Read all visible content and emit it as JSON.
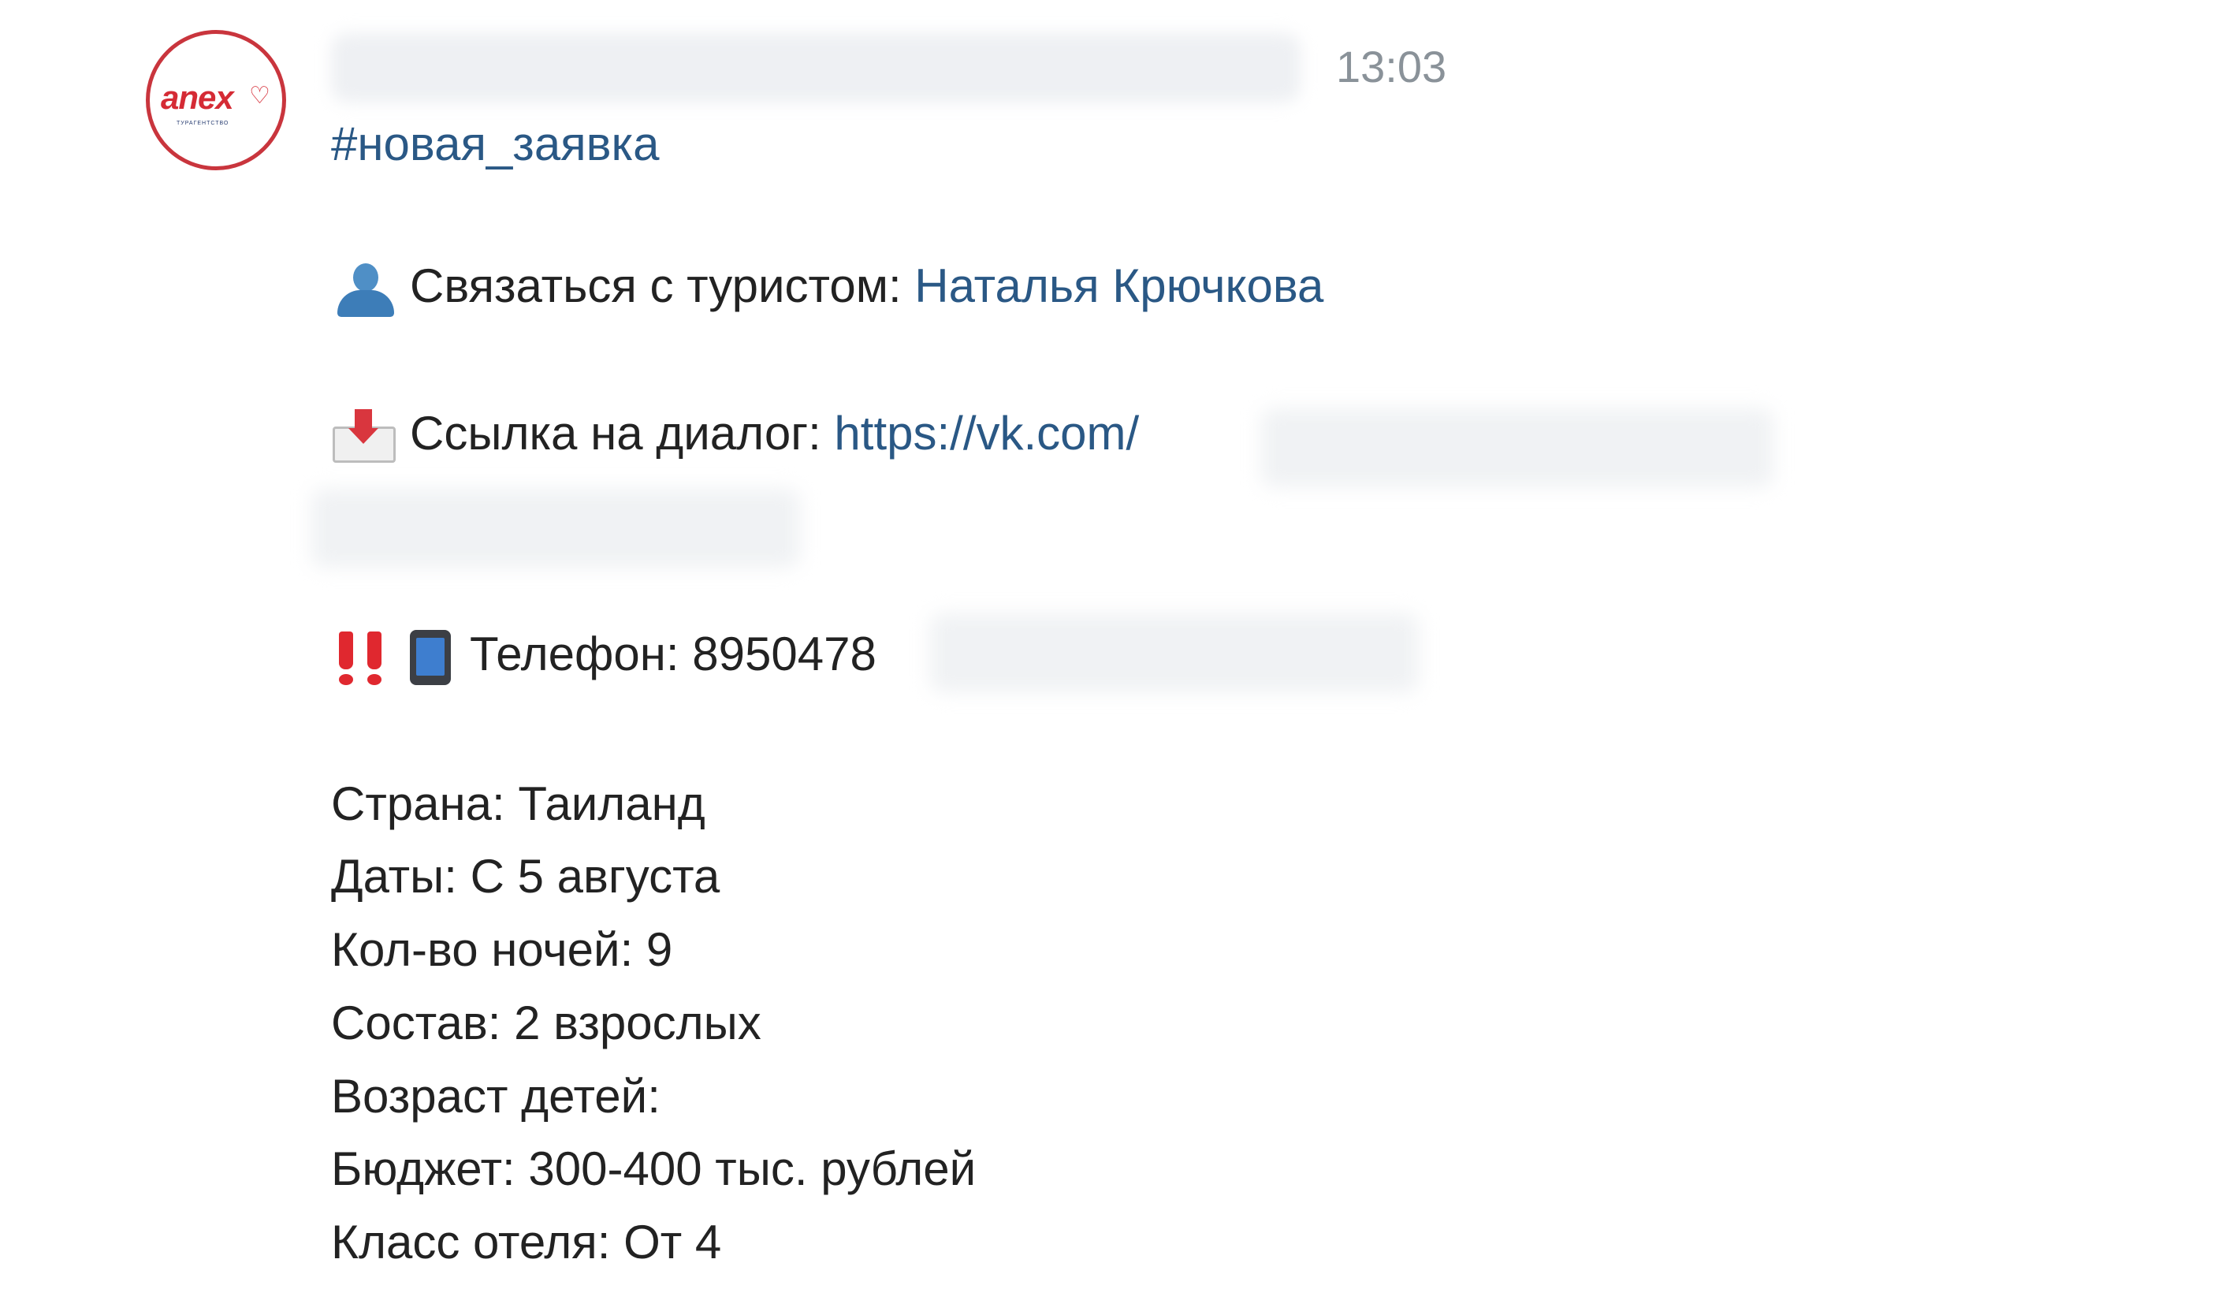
{
  "post": {
    "avatar": {
      "logo_text": "anex",
      "tagline": "ТУРАГЕНТСТВО"
    },
    "author_name": "",
    "timestamp": "13:03",
    "hashtag": "#новая_заявка",
    "contact": {
      "label": "Связаться с туристом: ",
      "name": "Наталья Крючкова"
    },
    "dialog": {
      "label": "Ссылка на диалог: ",
      "url_visible": "https://vk.com/"
    },
    "phone": {
      "label": "Телефон: ",
      "value_visible": "8950478"
    },
    "details": [
      "Страна: Таиланд",
      "Даты: С 5 августа",
      "Кол-во ночей: 9",
      "Состав: 2 взрослых",
      "Возраст детей:",
      "Бюджет: 300-400 тыс. рублей",
      "Класс отеля: От 4"
    ]
  },
  "icons": {
    "contact": "person-icon",
    "dialog": "incoming-envelope-icon",
    "phone_alert": "double-exclamation-icon",
    "phone": "mobile-phone-icon"
  },
  "colors": {
    "link": "#2a5885",
    "text": "#222222",
    "timestamp": "#8a9299",
    "brand": "#d52b35"
  }
}
